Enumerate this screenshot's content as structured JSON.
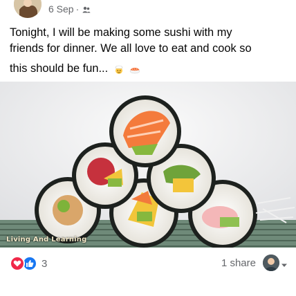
{
  "post": {
    "date": "6 Sep",
    "separator": "·",
    "audience_icon": "friends-icon",
    "text_lines": [
      "Tonight, I will be making some sushi with my",
      "friends for dinner. We all love to eat and cook so",
      "this should be fun..."
    ],
    "emojis": [
      "cook-emoji",
      "sushi-emoji"
    ]
  },
  "photo": {
    "description_icon": "sushi-photo",
    "watermark": "Living And Learning"
  },
  "footer": {
    "reactions": [
      "love",
      "like"
    ],
    "reaction_count": "3",
    "shares": "1 share",
    "colors": {
      "love": "#f02849",
      "like": "#1877f2",
      "muted": "#65676b"
    }
  }
}
